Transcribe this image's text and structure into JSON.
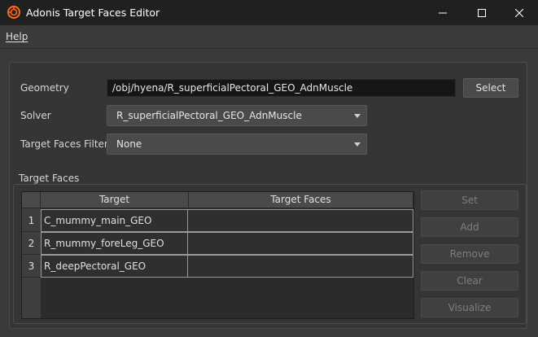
{
  "window": {
    "title": "Adonis Target Faces Editor",
    "icon": "houdini-logo-icon",
    "controls": [
      "minimize-icon",
      "maximize-icon",
      "close-icon"
    ]
  },
  "menu": {
    "help_label": "Help"
  },
  "form": {
    "geometry_label": "Geometry",
    "geometry_value": "/obj/hyena/R_superficialPectoral_GEO_AdnMuscle",
    "select_label": "Select",
    "solver_label": "Solver",
    "solver_value": "R_superficialPectoral_GEO_AdnMuscle",
    "filter_label": "Target Faces Filter",
    "filter_value": "None"
  },
  "target_faces": {
    "group_title": "Target Faces",
    "columns": [
      "Target",
      "Target Faces"
    ],
    "rows": [
      {
        "index": "1",
        "target": "C_mummy_main_GEO",
        "faces": ""
      },
      {
        "index": "2",
        "target": "R_mummy_foreLeg_GEO",
        "faces": ""
      },
      {
        "index": "3",
        "target": "R_deepPectoral_GEO",
        "faces": ""
      }
    ],
    "buttons": {
      "set": "Set",
      "add": "Add",
      "remove": "Remove",
      "clear": "Clear",
      "visualize": "Visualize"
    }
  },
  "colors": {
    "titlebar": "#202020",
    "background": "#3a3a3a",
    "brand_orange": "#ff6a1a"
  }
}
